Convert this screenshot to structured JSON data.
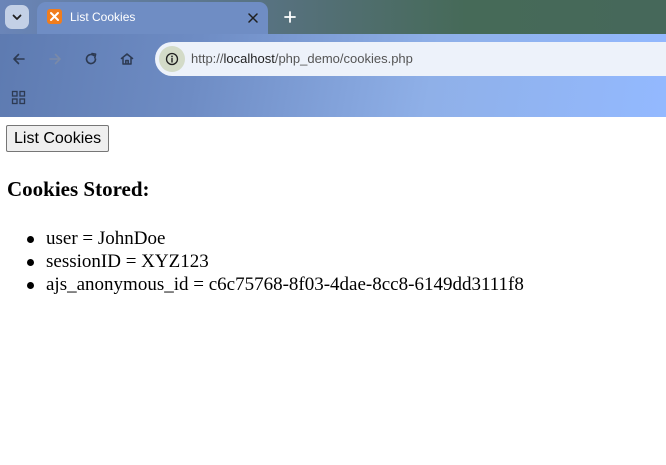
{
  "browser": {
    "tab": {
      "title": "List Cookies",
      "favicon": "xampp-icon"
    },
    "address_bar": {
      "scheme": "http://",
      "host": "localhost",
      "path": "/php_demo/cookies.php"
    },
    "colors": {
      "tab_strip": "#466a58",
      "toolbar": "#8fb0e8",
      "omnibox": "#edf2fa",
      "favicon": "#f07d1e"
    }
  },
  "page": {
    "button_label": "List Cookies",
    "heading": "Cookies Stored:",
    "cookies": [
      "user = JohnDoe",
      "sessionID = XYZ123",
      "ajs_anonymous_id = c6c75768-8f03-4dae-8cc8-6149dd3111f8"
    ]
  }
}
